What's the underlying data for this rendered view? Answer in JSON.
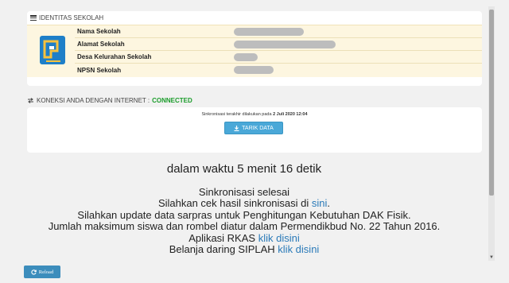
{
  "identitas": {
    "header": "IDENTITAS SEKOLAH",
    "rows": [
      {
        "label": "Nama Sekolah"
      },
      {
        "label": "Alamat Sekolah"
      },
      {
        "label": "Desa Kelurahan Sekolah"
      },
      {
        "label": "NPSN Sekolah"
      }
    ]
  },
  "koneksi": {
    "label": "KONEKSI ANDA DENGAN INTERNET :",
    "status": "CONNECTED",
    "status_color": "#1a9c2a",
    "sync_prefix": "Sinkronisasi terakhir dilakukan pada",
    "sync_date": "2 Juli 2020 12:04",
    "tarik_button": "TARIK DATA"
  },
  "messages": {
    "time": "dalam waktu 5 menit 16 detik",
    "selesai": "Sinkronisasi selesai",
    "cek_prefix": "Silahkan cek hasil sinkronisasi di",
    "cek_link": "sini",
    "cek_suffix": ".",
    "sarpras": "Silahkan update data sarpras untuk Penghitungan Kebutuhan DAK Fisik.",
    "rombel": "Jumlah maksimum siswa dan rombel diatur dalam Permendikbud No. 22 Tahun 2016.",
    "rkas_prefix": "Aplikasi RKAS",
    "rkas_link": "klik disini",
    "siplah_prefix": "Belanja daring SIPLAH",
    "siplah_link": "klik disini"
  },
  "reload_button": "Reload",
  "colors": {
    "accent_button": "#4aa8d8",
    "reload_button": "#3c8dbc",
    "link": "#2a7ab8"
  }
}
